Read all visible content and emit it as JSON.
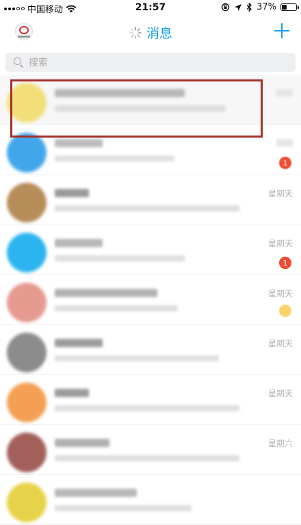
{
  "status_bar": {
    "carrier": "中国移动",
    "time": "21:57",
    "battery_percent_text": "37%",
    "battery_level": 0.37
  },
  "nav": {
    "title": "消息"
  },
  "search": {
    "placeholder": "搜索"
  },
  "rows": [
    {
      "time": "",
      "badge": "",
      "name_w": 190,
      "msg_w": 250,
      "avatar": "#f2df7a",
      "name_color": "#b8b8b8",
      "msg_color": "#dcdcdc",
      "pinned": true
    },
    {
      "time": "",
      "badge": "1",
      "name_w": 70,
      "msg_w": 175,
      "avatar": "#42a7ea",
      "name_color": "#bcbcbc",
      "msg_color": "#e0e0e0",
      "pinned": false
    },
    {
      "time": "星期天",
      "badge": "",
      "name_w": 50,
      "msg_w": 270,
      "avatar": "#b78d5a",
      "name_color": "#9a9a9a",
      "msg_color": "#dedede",
      "pinned": false
    },
    {
      "time": "星期天",
      "badge": "1",
      "name_w": 70,
      "msg_w": 190,
      "avatar": "#2cb4ef",
      "name_color": "#b6b6b6",
      "msg_color": "#dedede",
      "pinned": false
    },
    {
      "time": "星期天",
      "badge": "",
      "name_w": 150,
      "msg_w": 180,
      "avatar": "#e59b90",
      "name_color": "#b2b2b2",
      "msg_color": "#dedede",
      "pinned": false
    },
    {
      "time": "星期天",
      "badge": "",
      "name_w": 70,
      "msg_w": 240,
      "avatar": "#8c8c8c",
      "name_color": "#9c9c9c",
      "msg_color": "#e0e0e0",
      "pinned": false
    },
    {
      "time": "星期天",
      "badge": "",
      "name_w": 50,
      "msg_w": 270,
      "avatar": "#f3a054",
      "name_color": "#9c9c9c",
      "msg_color": "#e0e0e0",
      "pinned": false
    },
    {
      "time": "星期六",
      "badge": "",
      "name_w": 80,
      "msg_w": 270,
      "avatar": "#a3605b",
      "name_color": "#b0b0b0",
      "msg_color": "#dedede",
      "pinned": false
    },
    {
      "time": "",
      "badge": "",
      "name_w": 120,
      "msg_w": 200,
      "avatar": "#e7d34a",
      "name_color": "#b8b8b8",
      "msg_color": "#dedede",
      "pinned": false
    }
  ]
}
